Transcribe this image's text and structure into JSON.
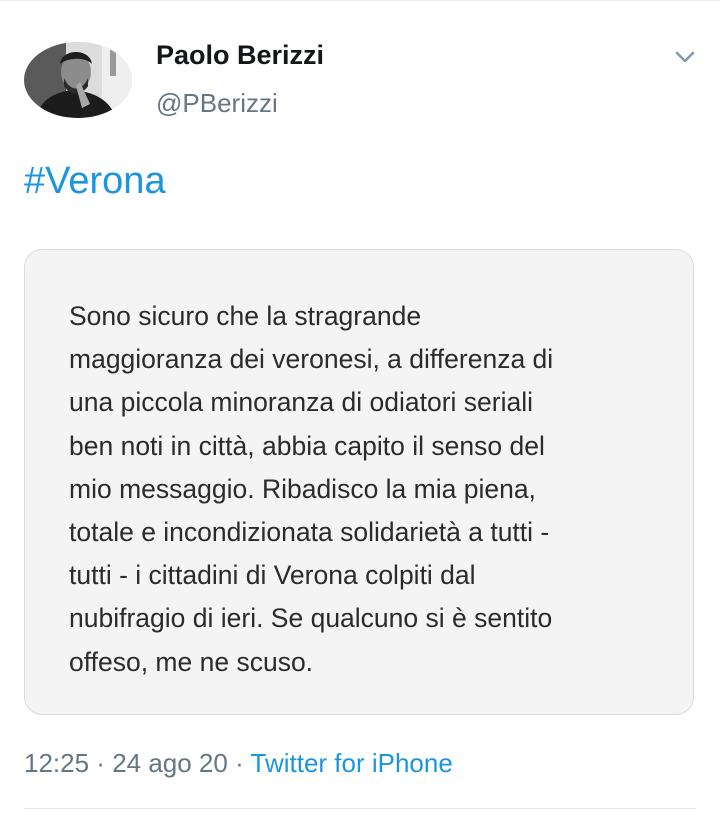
{
  "tweet": {
    "author": {
      "name": "Paolo Berizzi",
      "handle": "@PBerizzi"
    },
    "hashtag": "#Verona",
    "quote_text": "Sono sicuro che la stragrande\nmaggioranza dei veronesi, a differenza di\nuna piccola minoranza di odiatori seriali\nben noti in città, abbia capito il senso del\nmio messaggio. Ribadisco la mia piena,\ntotale e incondizionata solidarietà a tutti -\ntutti - i cittadini di Verona colpiti dal\nnubifragio di ieri. Se qualcuno si è sentito\noffeso, me ne scuso.",
    "meta": {
      "time": "12:25",
      "separator": " · ",
      "date": "24 ago 20",
      "source": "Twitter for iPhone"
    }
  },
  "icons": {
    "menu": "chevron-down-icon",
    "avatar": "profile-photo"
  },
  "colors": {
    "link": "#1b95e0",
    "secondary_text": "#657786",
    "card_background": "#f4f4f4"
  }
}
